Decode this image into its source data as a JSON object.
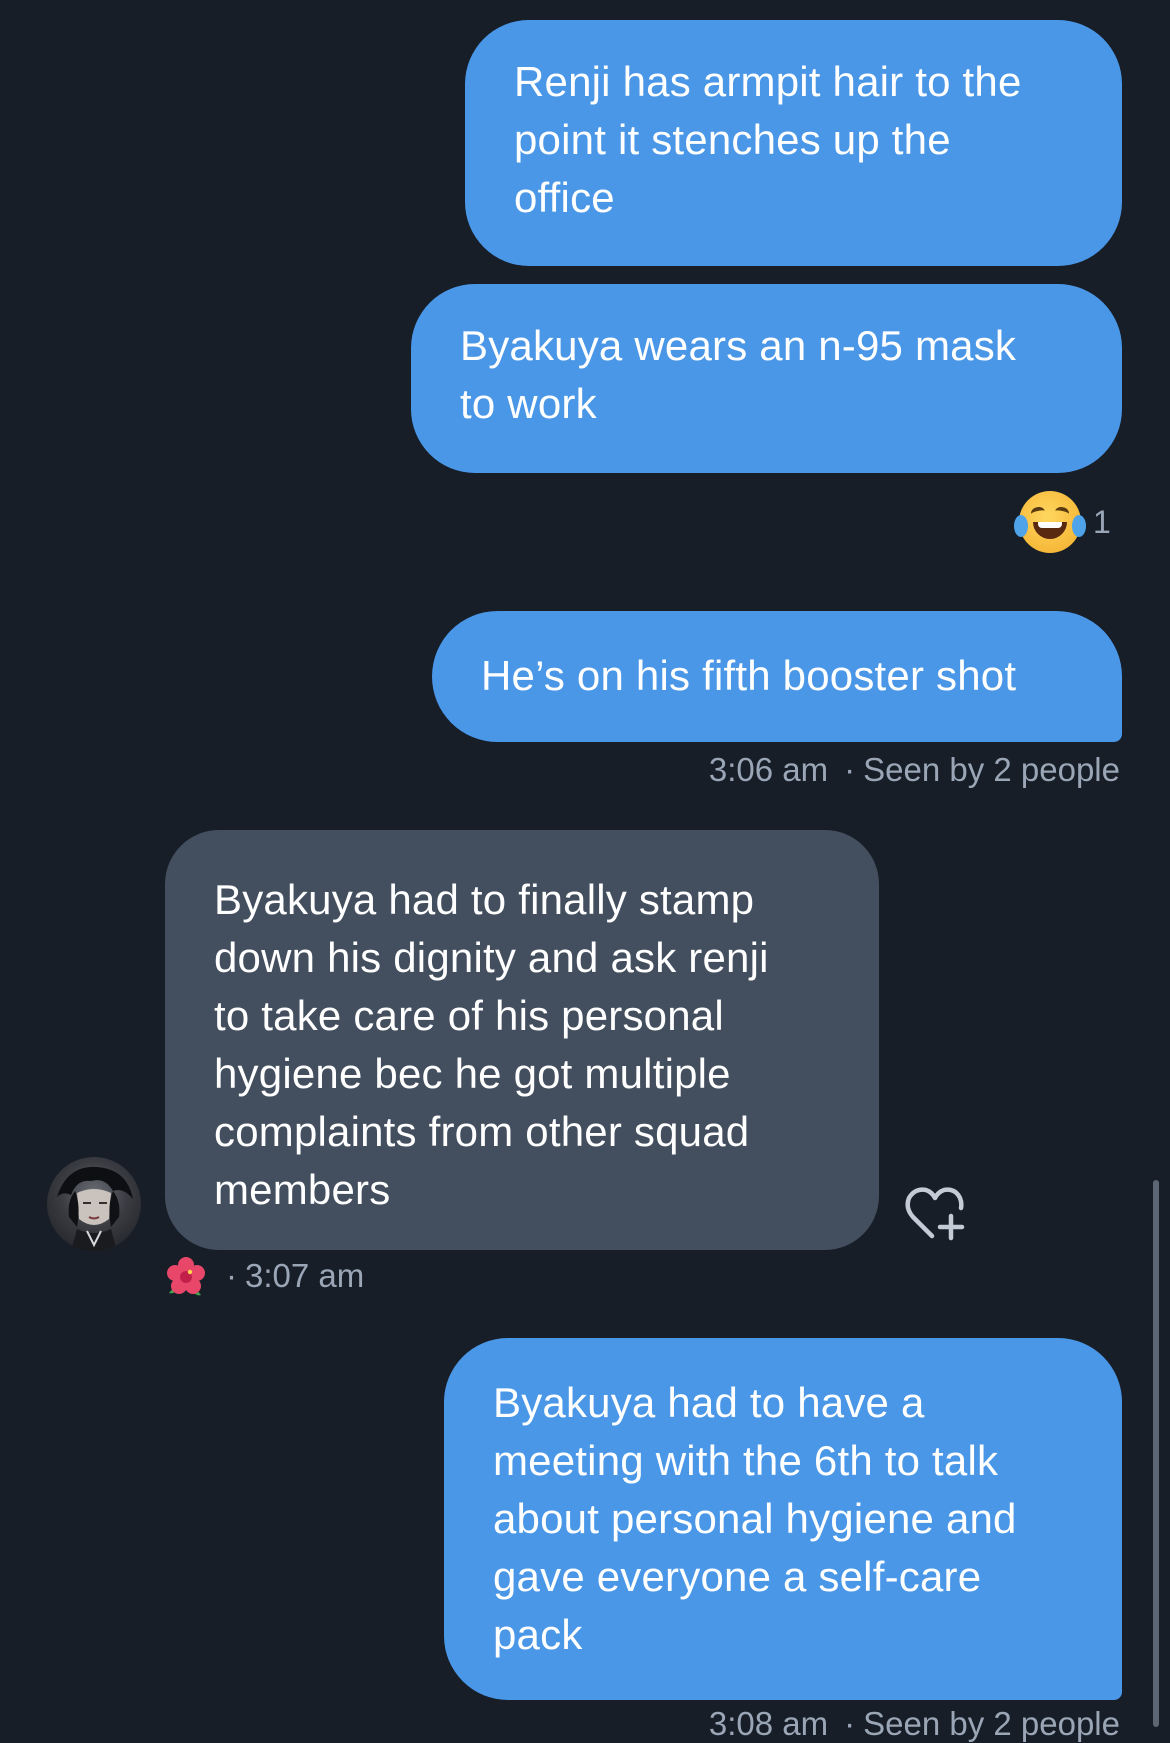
{
  "messages": [
    {
      "id": "m1",
      "direction": "outgoing",
      "text": "Renji has armpit hair to the\npoint it stenches up the\noffice"
    },
    {
      "id": "m2",
      "direction": "outgoing",
      "text": "Byakuya wears an n-95 mask\nto work",
      "reaction": {
        "emoji": "face-with-tears-of-joy",
        "count": "1"
      }
    },
    {
      "id": "m3",
      "direction": "outgoing",
      "text": "He’s on his fifth booster shot",
      "time": "3:06 am",
      "seen": "Seen by 2 people"
    },
    {
      "id": "m4",
      "direction": "incoming",
      "text": "Byakuya had to finally stamp\ndown his dignity and ask renji\nto take care of his personal\nhygiene bec he got multiple\ncomplaints from other squad\nmembers",
      "time": "3:07 am",
      "sender_icon": "hibiscus-icon"
    },
    {
      "id": "m5",
      "direction": "outgoing",
      "text": "Byakuya had to have a\nmeeting with the 6th to talk\nabout personal hygiene and\ngave everyone a self-care\npack",
      "time": "3:08 am",
      "seen": "Seen by 2 people"
    }
  ],
  "separator": "·",
  "colors": {
    "background": "#171e28",
    "outgoing_bubble": "#4a97e8",
    "incoming_bubble": "#434f5e",
    "meta_text": "#9aa6b6"
  },
  "icons": {
    "reaction": "face-with-tears-of-joy-icon",
    "add_reaction": "heart-plus-icon",
    "sender_badge": "hibiscus-icon"
  }
}
